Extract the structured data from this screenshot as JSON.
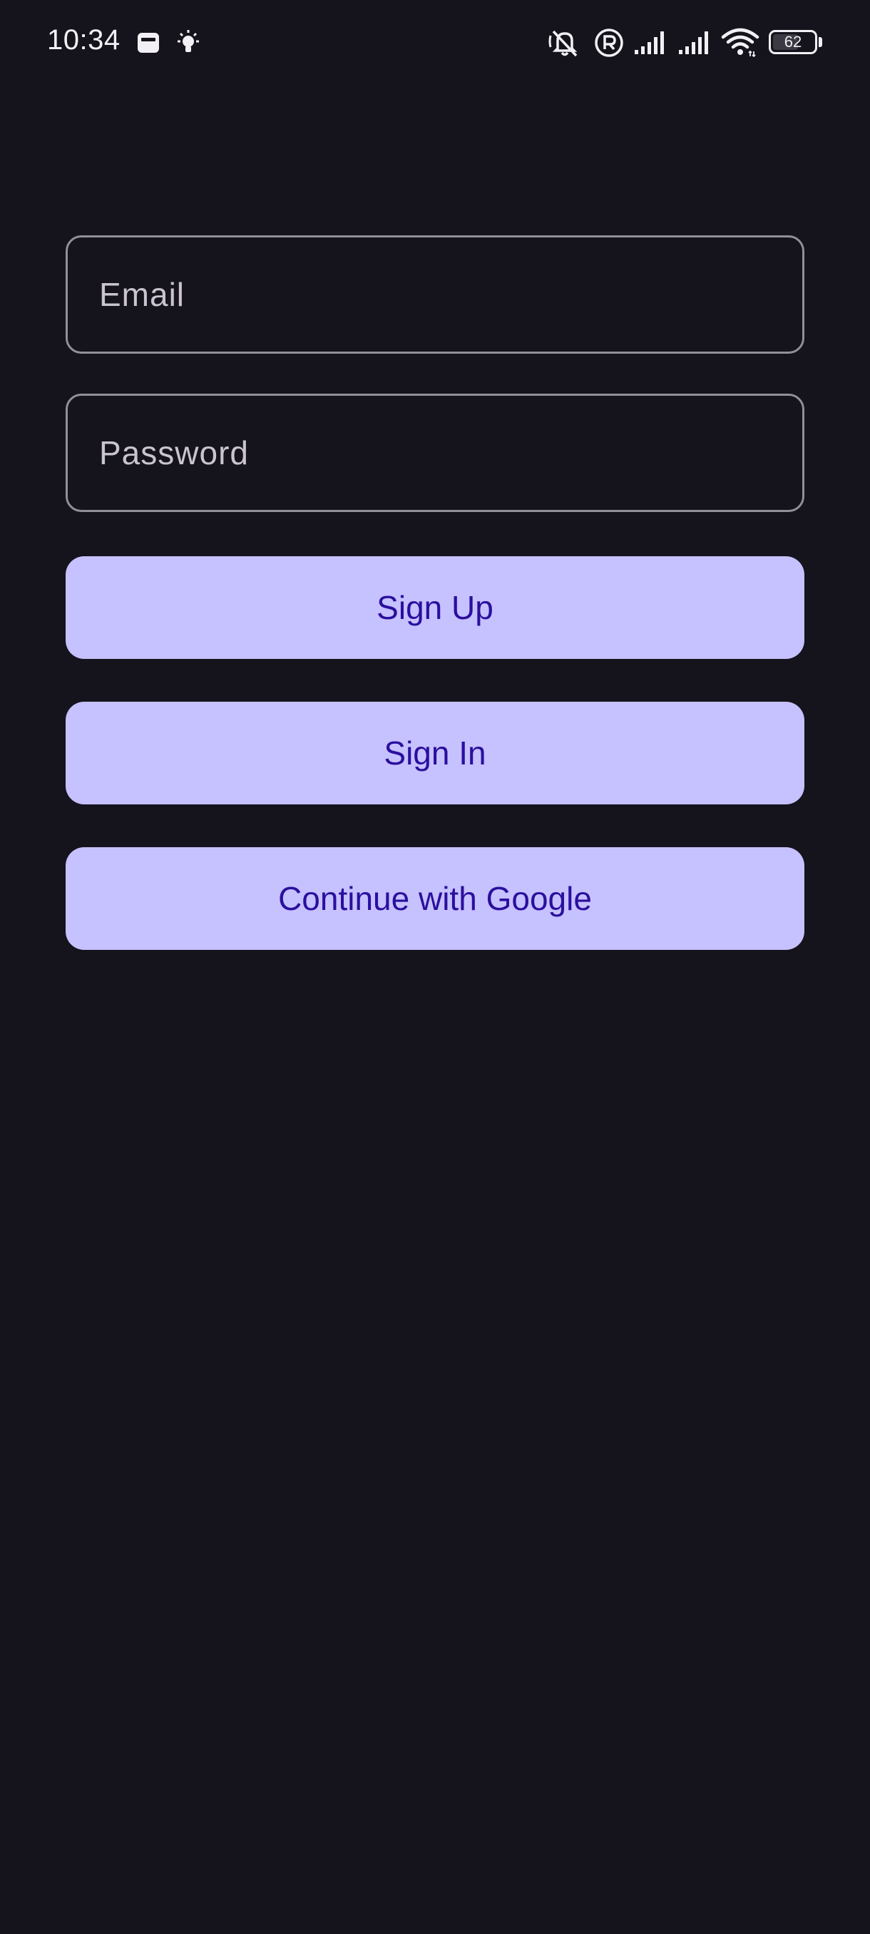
{
  "status_bar": {
    "time": "10:34",
    "icons": [
      "sim-card-icon",
      "lightbulb-icon",
      "bell-off-icon",
      "registered-icon",
      "signal-icon",
      "signal-icon",
      "wifi-icon",
      "battery-icon"
    ],
    "battery_percent": "62",
    "battery_level": 0.62
  },
  "form": {
    "email_placeholder": "Email",
    "email_value": "",
    "password_placeholder": "Password",
    "password_value": ""
  },
  "buttons": {
    "sign_up": "Sign Up",
    "sign_in": "Sign In",
    "google": "Continue with Google"
  },
  "colors": {
    "background": "#15131c",
    "button_bg": "#c6c1ff",
    "button_text": "#2a0f9e",
    "field_border": "#938f99"
  }
}
